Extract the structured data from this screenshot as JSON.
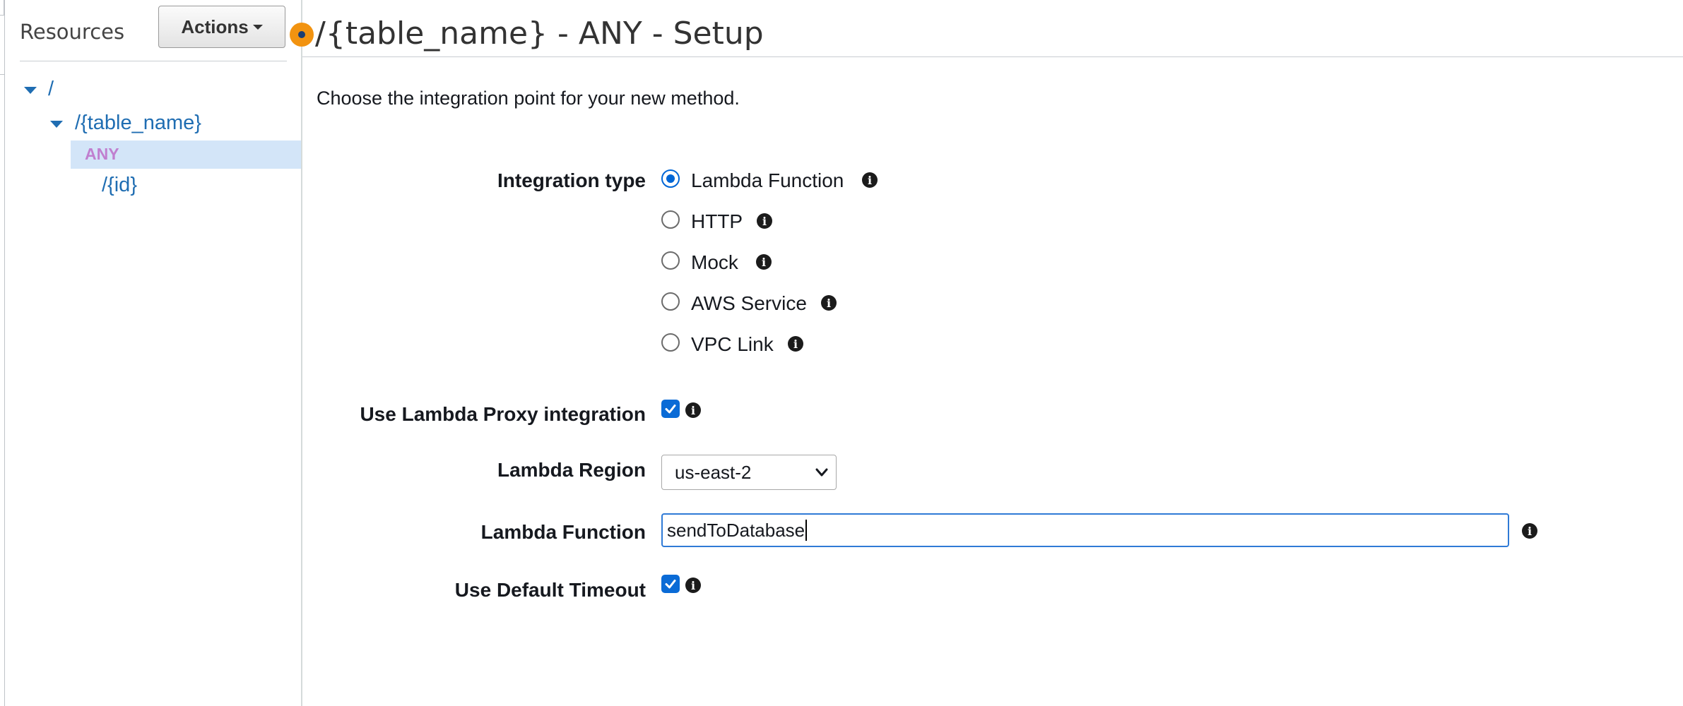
{
  "sidebar": {
    "title": "Resources",
    "actions_label": "Actions",
    "tree": {
      "root": "/",
      "table": "/{table_name}",
      "method": "ANY",
      "child": "/{id}"
    }
  },
  "header": {
    "title": "/{table_name} - ANY - Setup"
  },
  "main": {
    "intro": "Choose the integration point for your new method.",
    "integration_type": {
      "label": "Integration type",
      "selected": "Lambda Function",
      "options": [
        "Lambda Function",
        "HTTP",
        "Mock",
        "AWS Service",
        "VPC Link"
      ]
    },
    "proxy": {
      "label": "Use Lambda Proxy integration",
      "checked": true
    },
    "region": {
      "label": "Lambda Region",
      "value": "us-east-2"
    },
    "function": {
      "label": "Lambda Function",
      "value": "sendToDatabase"
    },
    "timeout": {
      "label": "Use Default Timeout",
      "checked": true
    }
  },
  "colors": {
    "link": "#1f6db2",
    "selected_row": "#d3e5f8",
    "method_text": "#c07fcf",
    "status_dot": "#f29310",
    "checkbox": "#0a6bd6"
  },
  "icons": [
    "info-icon",
    "chevron-down-icon",
    "caret-down-icon",
    "check-icon"
  ]
}
